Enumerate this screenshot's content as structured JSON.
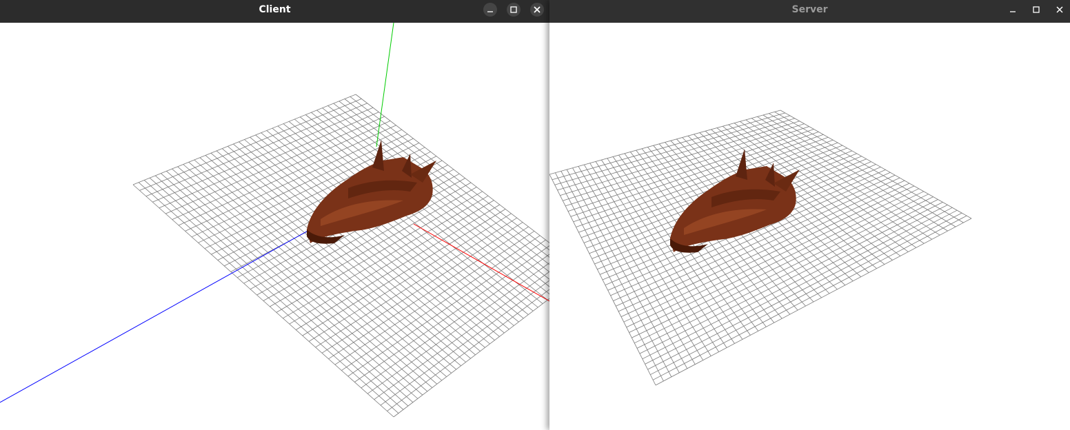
{
  "client_window": {
    "title": "Client",
    "controls": {
      "minimize": "minimize-icon",
      "maximize": "maximize-icon",
      "close": "close-icon"
    }
  },
  "server_window": {
    "title": "Server",
    "controls": {
      "minimize": "minimize-icon",
      "maximize": "maximize-icon",
      "close": "close-icon"
    }
  },
  "colors": {
    "titlebar": "#2c2c2c",
    "viewport_background": "#ffffff",
    "grid_lines": "#7a7a7a",
    "axis_x": "#ff0000",
    "axis_y": "#00cc00",
    "axis_z": "#0000ff",
    "model": "#7a3218"
  }
}
